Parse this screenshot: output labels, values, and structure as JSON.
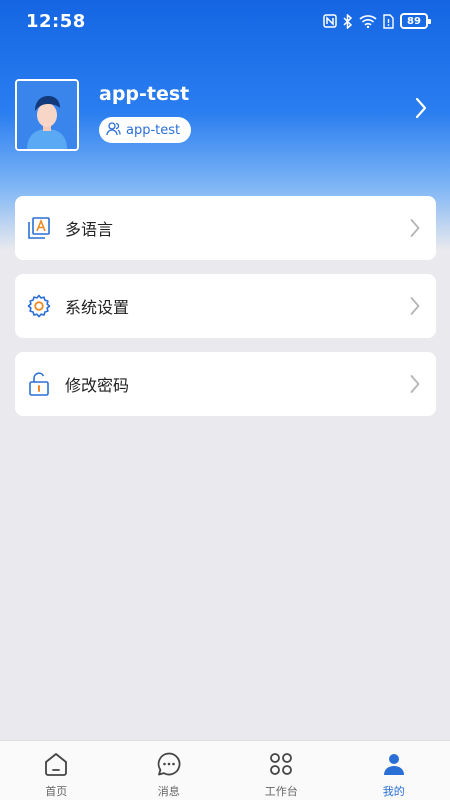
{
  "status_bar": {
    "time": "12:58",
    "battery": "89",
    "icons": [
      "nfc-icon",
      "bluetooth-icon",
      "wifi-icon",
      "sim-alert-icon",
      "battery-icon"
    ]
  },
  "profile": {
    "username": "app-test",
    "role": "app-test",
    "icons": [
      "avatar",
      "users-icon",
      "chevron-right-icon"
    ]
  },
  "menu": [
    {
      "label": "多语言",
      "icon": "language-icon"
    },
    {
      "label": "系统设置",
      "icon": "gear-icon"
    },
    {
      "label": "修改密码",
      "icon": "unlock-icon"
    }
  ],
  "tabbar": {
    "tabs": [
      {
        "label": "首页",
        "icon": "home-icon"
      },
      {
        "label": "消息",
        "icon": "message-icon"
      },
      {
        "label": "工作台",
        "icon": "workbench-icon"
      },
      {
        "label": "我的",
        "icon": "user-icon",
        "active": true
      }
    ]
  },
  "colors": {
    "accent": "#2a6fd6",
    "header_top": "#1565e3",
    "page_bg": "#e9e9ee"
  }
}
